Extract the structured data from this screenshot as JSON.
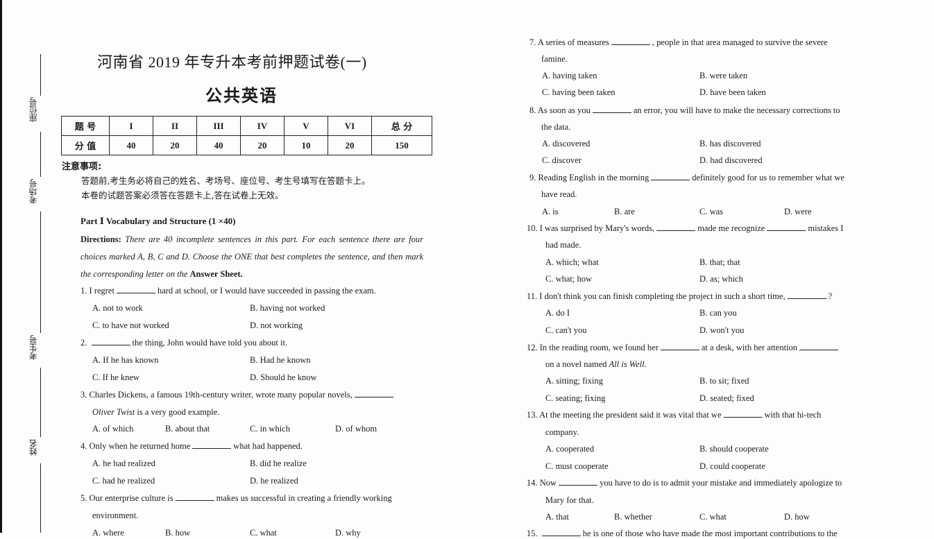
{
  "binding_labels": [
    "座位号",
    "考场号",
    "考生号",
    "姓名"
  ],
  "header": {
    "title": "河南省 2019 年专升本考前押题试卷(一)",
    "subtitle": "公共英语"
  },
  "score_table": {
    "row_headers": [
      "题 号",
      "分 值"
    ],
    "parts": [
      "I",
      "II",
      "III",
      "IV",
      "V",
      "VI",
      "总 分"
    ],
    "points": [
      "40",
      "20",
      "40",
      "20",
      "10",
      "20",
      "150"
    ]
  },
  "notice": {
    "heading": "注意事项:",
    "lines": [
      "答题前,考生务必将自己的姓名、考场号、座位号、考生号填写在答题卡上。",
      "本卷的试题答案必须答在答题卡上,答在试卷上无效。"
    ]
  },
  "part1": {
    "title": "Part Ⅰ Vocabulary and Structure (1 ×40)",
    "directions_label": "Directions:",
    "directions_text": "There are 40 incomplete sentences in this part. For each sentence there are four choices marked A, B, C and D. Choose the ONE that best completes the sentence, and then mark the corresponding letter on the",
    "directions_bold_end": "Answer Sheet."
  },
  "questions": [
    {
      "n": "1.",
      "pre": "I regret",
      "post": "hard at school, or I would have succeeded in passing the exam.",
      "options": [
        "A. not to work",
        "B. having not worked",
        "C. to have not worked",
        "D. not working"
      ]
    },
    {
      "n": "2.",
      "pre": "",
      "post": "the thing, John would have told you about it.",
      "options": [
        "A. If he has known",
        "B. Had he known",
        "C. If he knew",
        "D. Should he know"
      ]
    },
    {
      "n": "3.",
      "pre": "Charles Dickens, a famous 19th-century writer, wrote many popular novels,",
      "post": "",
      "cont_italic": "Oliver Twist",
      "cont": " is a very good example.",
      "options": [
        "A. of which",
        "B. about that",
        "C. in which",
        "D. of whom"
      ]
    },
    {
      "n": "4.",
      "pre": "Only when he returned home",
      "post": "what had happened.",
      "options": [
        "A. he had realized",
        "B. did he realize",
        "C. had he realized",
        "D. he realized"
      ]
    },
    {
      "n": "5.",
      "pre": "Our enterprise culture is",
      "post": "makes us successful in creating a friendly working",
      "cont": "environment.",
      "options": [
        "A. where",
        "B. how",
        "C. what",
        "D. why"
      ]
    },
    {
      "n": "7.",
      "pre": "A series of measures",
      "post": ", people in that area managed to survive the severe",
      "cont": "famine.",
      "options": [
        "A. having taken",
        "B. were taken",
        "C. having been taken",
        "D. have been taken"
      ]
    },
    {
      "n": "8.",
      "pre": "As soon as you",
      "post": "an error, you will have to make the necessary corrections to",
      "cont": "the data.",
      "options": [
        "A. discovered",
        "B. has discovered",
        "C. discover",
        "D. had discovered"
      ]
    },
    {
      "n": "9.",
      "pre": "Reading English in the morning",
      "post": "definitely good for us to remember what we",
      "cont": "have read.",
      "options": [
        "A. is",
        "B. are",
        "C. was",
        "D. were"
      ]
    },
    {
      "n": "10.",
      "pre": "I was surprised by Mary's words,",
      "mid": "made me recognize",
      "post": "mistakes I",
      "cont": "had made.",
      "options": [
        "A. which; what",
        "B. that; that",
        "C. what; how",
        "D. as; which"
      ]
    },
    {
      "n": "11.",
      "pre": "I don't think you can finish completing the project in such a short time,",
      "post": "?",
      "options": [
        "A. do I",
        "B. can you",
        "C. can't you",
        "D. won't you"
      ]
    },
    {
      "n": "12.",
      "pre": "In the reading room, we found her",
      "mid": "at a desk, with her attention",
      "post": "",
      "cont": "on a novel named ",
      "cont_italic": "All is Well",
      "cont_end": ".",
      "options": [
        "A. sitting; fixing",
        "B. to sit; fixed",
        "C. seating; fixing",
        "D. seated; fixed"
      ]
    },
    {
      "n": "13.",
      "pre": "At the meeting the president said it was vital that we",
      "post": "with that hi-tech",
      "cont": "company.",
      "options": [
        "A. cooperated",
        "B. should cooperate",
        "C. must cooperate",
        "D. could cooperate"
      ]
    },
    {
      "n": "14.",
      "pre": "Now",
      "post": "you have to do is to admit your mistake and immediately apologize to",
      "cont": "Mary for that.",
      "options": [
        "A. that",
        "B. whether",
        "C. what",
        "D. how"
      ]
    },
    {
      "n": "15.",
      "pre": "",
      "post": "he is one of those who have made the most important contributions to the"
    }
  ]
}
